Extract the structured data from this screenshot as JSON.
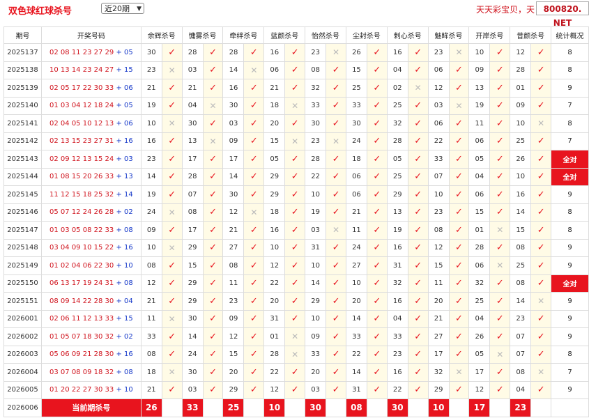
{
  "header": {
    "title": "双色球红球杀号",
    "period_select": "近20期",
    "brand": "天天彩宝贝，天",
    "domain": "800820. NET"
  },
  "columns": [
    "期号",
    "开奖号码",
    "余辉杀号",
    "慵雾杀号",
    "牵绊杀号",
    "蓝颜杀号",
    "怡然杀号",
    "尘封杀号",
    "刺心杀号",
    "魅眸杀号",
    "开岸杀号",
    "昔颜杀号",
    "统计概况"
  ],
  "rows": [
    {
      "issue": "2025137",
      "red": "02 08 11 23 27 29",
      "blue": "05",
      "kills": [
        [
          "30",
          1
        ],
        [
          "28",
          1
        ],
        [
          "28",
          1
        ],
        [
          "16",
          1
        ],
        [
          "23",
          0
        ],
        [
          "26",
          1
        ],
        [
          "16",
          1
        ],
        [
          "23",
          0
        ],
        [
          "10",
          1
        ],
        [
          "12",
          1
        ]
      ],
      "stat": "8"
    },
    {
      "issue": "2025138",
      "red": "10 13 14 23 24 27",
      "blue": "15",
      "kills": [
        [
          "23",
          0
        ],
        [
          "03",
          1
        ],
        [
          "14",
          0
        ],
        [
          "06",
          1
        ],
        [
          "08",
          1
        ],
        [
          "15",
          1
        ],
        [
          "04",
          1
        ],
        [
          "06",
          1
        ],
        [
          "09",
          1
        ],
        [
          "28",
          1
        ]
      ],
      "stat": "8"
    },
    {
      "issue": "2025139",
      "red": "02 05 17 22 30 33",
      "blue": "06",
      "kills": [
        [
          "21",
          1
        ],
        [
          "21",
          1
        ],
        [
          "16",
          1
        ],
        [
          "21",
          1
        ],
        [
          "32",
          1
        ],
        [
          "25",
          1
        ],
        [
          "02",
          0
        ],
        [
          "12",
          1
        ],
        [
          "13",
          1
        ],
        [
          "01",
          1
        ]
      ],
      "stat": "9"
    },
    {
      "issue": "2025140",
      "red": "01 03 04 12 18 24",
      "blue": "05",
      "kills": [
        [
          "19",
          1
        ],
        [
          "04",
          0
        ],
        [
          "30",
          1
        ],
        [
          "18",
          0
        ],
        [
          "33",
          1
        ],
        [
          "33",
          1
        ],
        [
          "25",
          1
        ],
        [
          "03",
          0
        ],
        [
          "19",
          1
        ],
        [
          "09",
          1
        ]
      ],
      "stat": "7"
    },
    {
      "issue": "2025141",
      "red": "02 04 05 10 12 13",
      "blue": "06",
      "kills": [
        [
          "10",
          0
        ],
        [
          "30",
          1
        ],
        [
          "03",
          1
        ],
        [
          "20",
          1
        ],
        [
          "30",
          1
        ],
        [
          "30",
          1
        ],
        [
          "32",
          1
        ],
        [
          "06",
          1
        ],
        [
          "11",
          1
        ],
        [
          "10",
          0
        ]
      ],
      "stat": "8"
    },
    {
      "issue": "2025142",
      "red": "02 13 15 23 27 31",
      "blue": "16",
      "kills": [
        [
          "16",
          1
        ],
        [
          "13",
          0
        ],
        [
          "09",
          1
        ],
        [
          "15",
          0
        ],
        [
          "23",
          0
        ],
        [
          "24",
          1
        ],
        [
          "28",
          1
        ],
        [
          "22",
          1
        ],
        [
          "06",
          1
        ],
        [
          "25",
          1
        ]
      ],
      "stat": "7"
    },
    {
      "issue": "2025143",
      "red": "02 09 12 13 15 24",
      "blue": "03",
      "kills": [
        [
          "23",
          1
        ],
        [
          "17",
          1
        ],
        [
          "17",
          1
        ],
        [
          "05",
          1
        ],
        [
          "28",
          1
        ],
        [
          "18",
          1
        ],
        [
          "05",
          1
        ],
        [
          "33",
          1
        ],
        [
          "05",
          1
        ],
        [
          "26",
          1
        ]
      ],
      "stat": "全对"
    },
    {
      "issue": "2025144",
      "red": "01 08 15 20 26 33",
      "blue": "13",
      "kills": [
        [
          "14",
          1
        ],
        [
          "28",
          1
        ],
        [
          "14",
          1
        ],
        [
          "29",
          1
        ],
        [
          "22",
          1
        ],
        [
          "06",
          1
        ],
        [
          "25",
          1
        ],
        [
          "07",
          1
        ],
        [
          "04",
          1
        ],
        [
          "10",
          1
        ]
      ],
      "stat": "全对"
    },
    {
      "issue": "2025145",
      "red": "11 12 15 18 25 32",
      "blue": "14",
      "kills": [
        [
          "19",
          1
        ],
        [
          "07",
          1
        ],
        [
          "30",
          1
        ],
        [
          "29",
          1
        ],
        [
          "10",
          1
        ],
        [
          "06",
          1
        ],
        [
          "29",
          1
        ],
        [
          "10",
          1
        ],
        [
          "06",
          1
        ],
        [
          "16",
          1
        ]
      ],
      "stat": "9"
    },
    {
      "issue": "2025146",
      "red": "05 07 12 24 26 28",
      "blue": "02",
      "kills": [
        [
          "24",
          0
        ],
        [
          "08",
          1
        ],
        [
          "12",
          0
        ],
        [
          "18",
          1
        ],
        [
          "19",
          1
        ],
        [
          "21",
          1
        ],
        [
          "13",
          1
        ],
        [
          "23",
          1
        ],
        [
          "15",
          1
        ],
        [
          "14",
          1
        ]
      ],
      "stat": "8"
    },
    {
      "issue": "2025147",
      "red": "01 03 05 08 22 33",
      "blue": "08",
      "kills": [
        [
          "09",
          1
        ],
        [
          "17",
          1
        ],
        [
          "21",
          1
        ],
        [
          "16",
          1
        ],
        [
          "03",
          0
        ],
        [
          "11",
          1
        ],
        [
          "19",
          1
        ],
        [
          "08",
          1
        ],
        [
          "01",
          0
        ],
        [
          "15",
          1
        ]
      ],
      "stat": "8"
    },
    {
      "issue": "2025148",
      "red": "03 04 09 10 15 22",
      "blue": "16",
      "kills": [
        [
          "10",
          0
        ],
        [
          "29",
          1
        ],
        [
          "27",
          1
        ],
        [
          "10",
          1
        ],
        [
          "31",
          1
        ],
        [
          "24",
          1
        ],
        [
          "16",
          1
        ],
        [
          "12",
          1
        ],
        [
          "28",
          1
        ],
        [
          "08",
          1
        ]
      ],
      "stat": "9"
    },
    {
      "issue": "2025149",
      "red": "01 02 04 06 22 30",
      "blue": "10",
      "kills": [
        [
          "08",
          1
        ],
        [
          "15",
          1
        ],
        [
          "08",
          1
        ],
        [
          "12",
          1
        ],
        [
          "10",
          1
        ],
        [
          "27",
          1
        ],
        [
          "31",
          1
        ],
        [
          "15",
          1
        ],
        [
          "06",
          0
        ],
        [
          "25",
          1
        ]
      ],
      "stat": "9"
    },
    {
      "issue": "2025150",
      "red": "06 13 17 19 24 31",
      "blue": "08",
      "kills": [
        [
          "12",
          1
        ],
        [
          "29",
          1
        ],
        [
          "11",
          1
        ],
        [
          "22",
          1
        ],
        [
          "14",
          1
        ],
        [
          "10",
          1
        ],
        [
          "32",
          1
        ],
        [
          "11",
          1
        ],
        [
          "32",
          1
        ],
        [
          "08",
          1
        ]
      ],
      "stat": "全对"
    },
    {
      "issue": "2025151",
      "red": "08 09 14 22 28 30",
      "blue": "04",
      "kills": [
        [
          "21",
          1
        ],
        [
          "29",
          1
        ],
        [
          "23",
          1
        ],
        [
          "20",
          1
        ],
        [
          "29",
          1
        ],
        [
          "20",
          1
        ],
        [
          "16",
          1
        ],
        [
          "20",
          1
        ],
        [
          "25",
          1
        ],
        [
          "14",
          0
        ]
      ],
      "stat": "9"
    },
    {
      "issue": "2026001",
      "red": "02 06 11 12 13 33",
      "blue": "15",
      "kills": [
        [
          "11",
          0
        ],
        [
          "30",
          1
        ],
        [
          "09",
          1
        ],
        [
          "31",
          1
        ],
        [
          "10",
          1
        ],
        [
          "14",
          1
        ],
        [
          "04",
          1
        ],
        [
          "21",
          1
        ],
        [
          "04",
          1
        ],
        [
          "23",
          1
        ]
      ],
      "stat": "9"
    },
    {
      "issue": "2026002",
      "red": "01 05 07 18 30 32",
      "blue": "02",
      "kills": [
        [
          "33",
          1
        ],
        [
          "14",
          1
        ],
        [
          "12",
          1
        ],
        [
          "01",
          0
        ],
        [
          "09",
          1
        ],
        [
          "33",
          1
        ],
        [
          "33",
          1
        ],
        [
          "27",
          1
        ],
        [
          "26",
          1
        ],
        [
          "07",
          1
        ]
      ],
      "stat": "9"
    },
    {
      "issue": "2026003",
      "red": "05 06 09 21 28 30",
      "blue": "16",
      "kills": [
        [
          "08",
          1
        ],
        [
          "24",
          1
        ],
        [
          "15",
          1
        ],
        [
          "28",
          0
        ],
        [
          "33",
          1
        ],
        [
          "22",
          1
        ],
        [
          "23",
          1
        ],
        [
          "17",
          1
        ],
        [
          "05",
          0
        ],
        [
          "07",
          1
        ]
      ],
      "stat": "8"
    },
    {
      "issue": "2026004",
      "red": "03 07 08 09 18 32",
      "blue": "08",
      "kills": [
        [
          "18",
          0
        ],
        [
          "30",
          1
        ],
        [
          "20",
          1
        ],
        [
          "22",
          1
        ],
        [
          "20",
          1
        ],
        [
          "14",
          1
        ],
        [
          "16",
          1
        ],
        [
          "32",
          0
        ],
        [
          "17",
          1
        ],
        [
          "08",
          0
        ]
      ],
      "stat": "7"
    },
    {
      "issue": "2026005",
      "red": "01 20 22 27 30 33",
      "blue": "10",
      "kills": [
        [
          "21",
          1
        ],
        [
          "03",
          1
        ],
        [
          "29",
          1
        ],
        [
          "12",
          1
        ],
        [
          "03",
          1
        ],
        [
          "31",
          1
        ],
        [
          "22",
          1
        ],
        [
          "29",
          1
        ],
        [
          "12",
          1
        ],
        [
          "04",
          1
        ]
      ],
      "stat": "9"
    }
  ],
  "current": {
    "issue": "2026006",
    "label": "当前期杀号",
    "kills": [
      "26",
      "33",
      "25",
      "10",
      "30",
      "08",
      "30",
      "10",
      "17",
      "23"
    ]
  },
  "marks": {
    "ok": "✓",
    "no": "✕"
  },
  "colors": {
    "red": "#e8141e",
    "blue": "#1336c8",
    "mark_bg": "#fffbe6"
  }
}
